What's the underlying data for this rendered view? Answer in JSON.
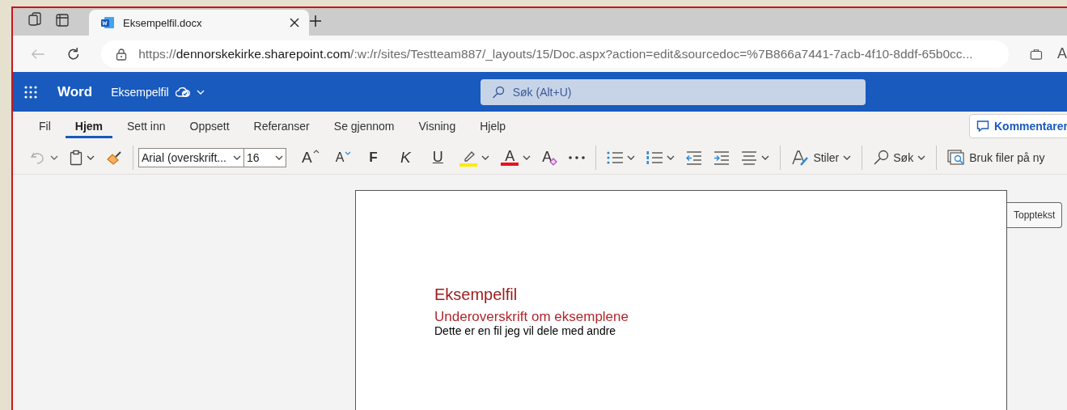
{
  "browser": {
    "tabs": [
      {
        "title": "Eksempelfil.docx",
        "selected": true
      }
    ],
    "address": {
      "scheme": "https://",
      "host": "dennorskekirke.sharepoint.com",
      "path": "/:w:/r/sites/Testteam887/_layouts/15/Doc.aspx?action=edit&sourcedoc=%7B866a7441-7acb-4f10-8ddf-65b0cc..."
    },
    "read_aloud": "A"
  },
  "app": {
    "name": "Word",
    "document": "Eksempelfil",
    "search": {
      "placeholder": "Søk (Alt+U)"
    }
  },
  "ribbon": {
    "tabs": [
      {
        "label": "Fil",
        "selected": false
      },
      {
        "label": "Hjem",
        "selected": true
      },
      {
        "label": "Sett inn",
        "selected": false
      },
      {
        "label": "Oppsett",
        "selected": false
      },
      {
        "label": "Referanser",
        "selected": false
      },
      {
        "label": "Se gjennom",
        "selected": false
      },
      {
        "label": "Visning",
        "selected": false
      },
      {
        "label": "Hjelp",
        "selected": false
      }
    ],
    "comments_button": "Kommentarer"
  },
  "toolbar": {
    "font_name": "Arial (overskrift...",
    "font_size": "16",
    "grow_font": "A",
    "shrink_font": "A",
    "bold": "F",
    "italic": "K",
    "underline": "U",
    "font_color": "A",
    "clear_formatting": "A",
    "styles": "Stiler",
    "find": "Søk",
    "reuse_files": "Bruk filer på ny"
  },
  "document": {
    "header_button": "Topptekst",
    "title": "Eksempelfil",
    "subtitle": "Underoverskrift om eksemplene",
    "body": "Dette er en fil jeg vil dele med andre"
  }
}
